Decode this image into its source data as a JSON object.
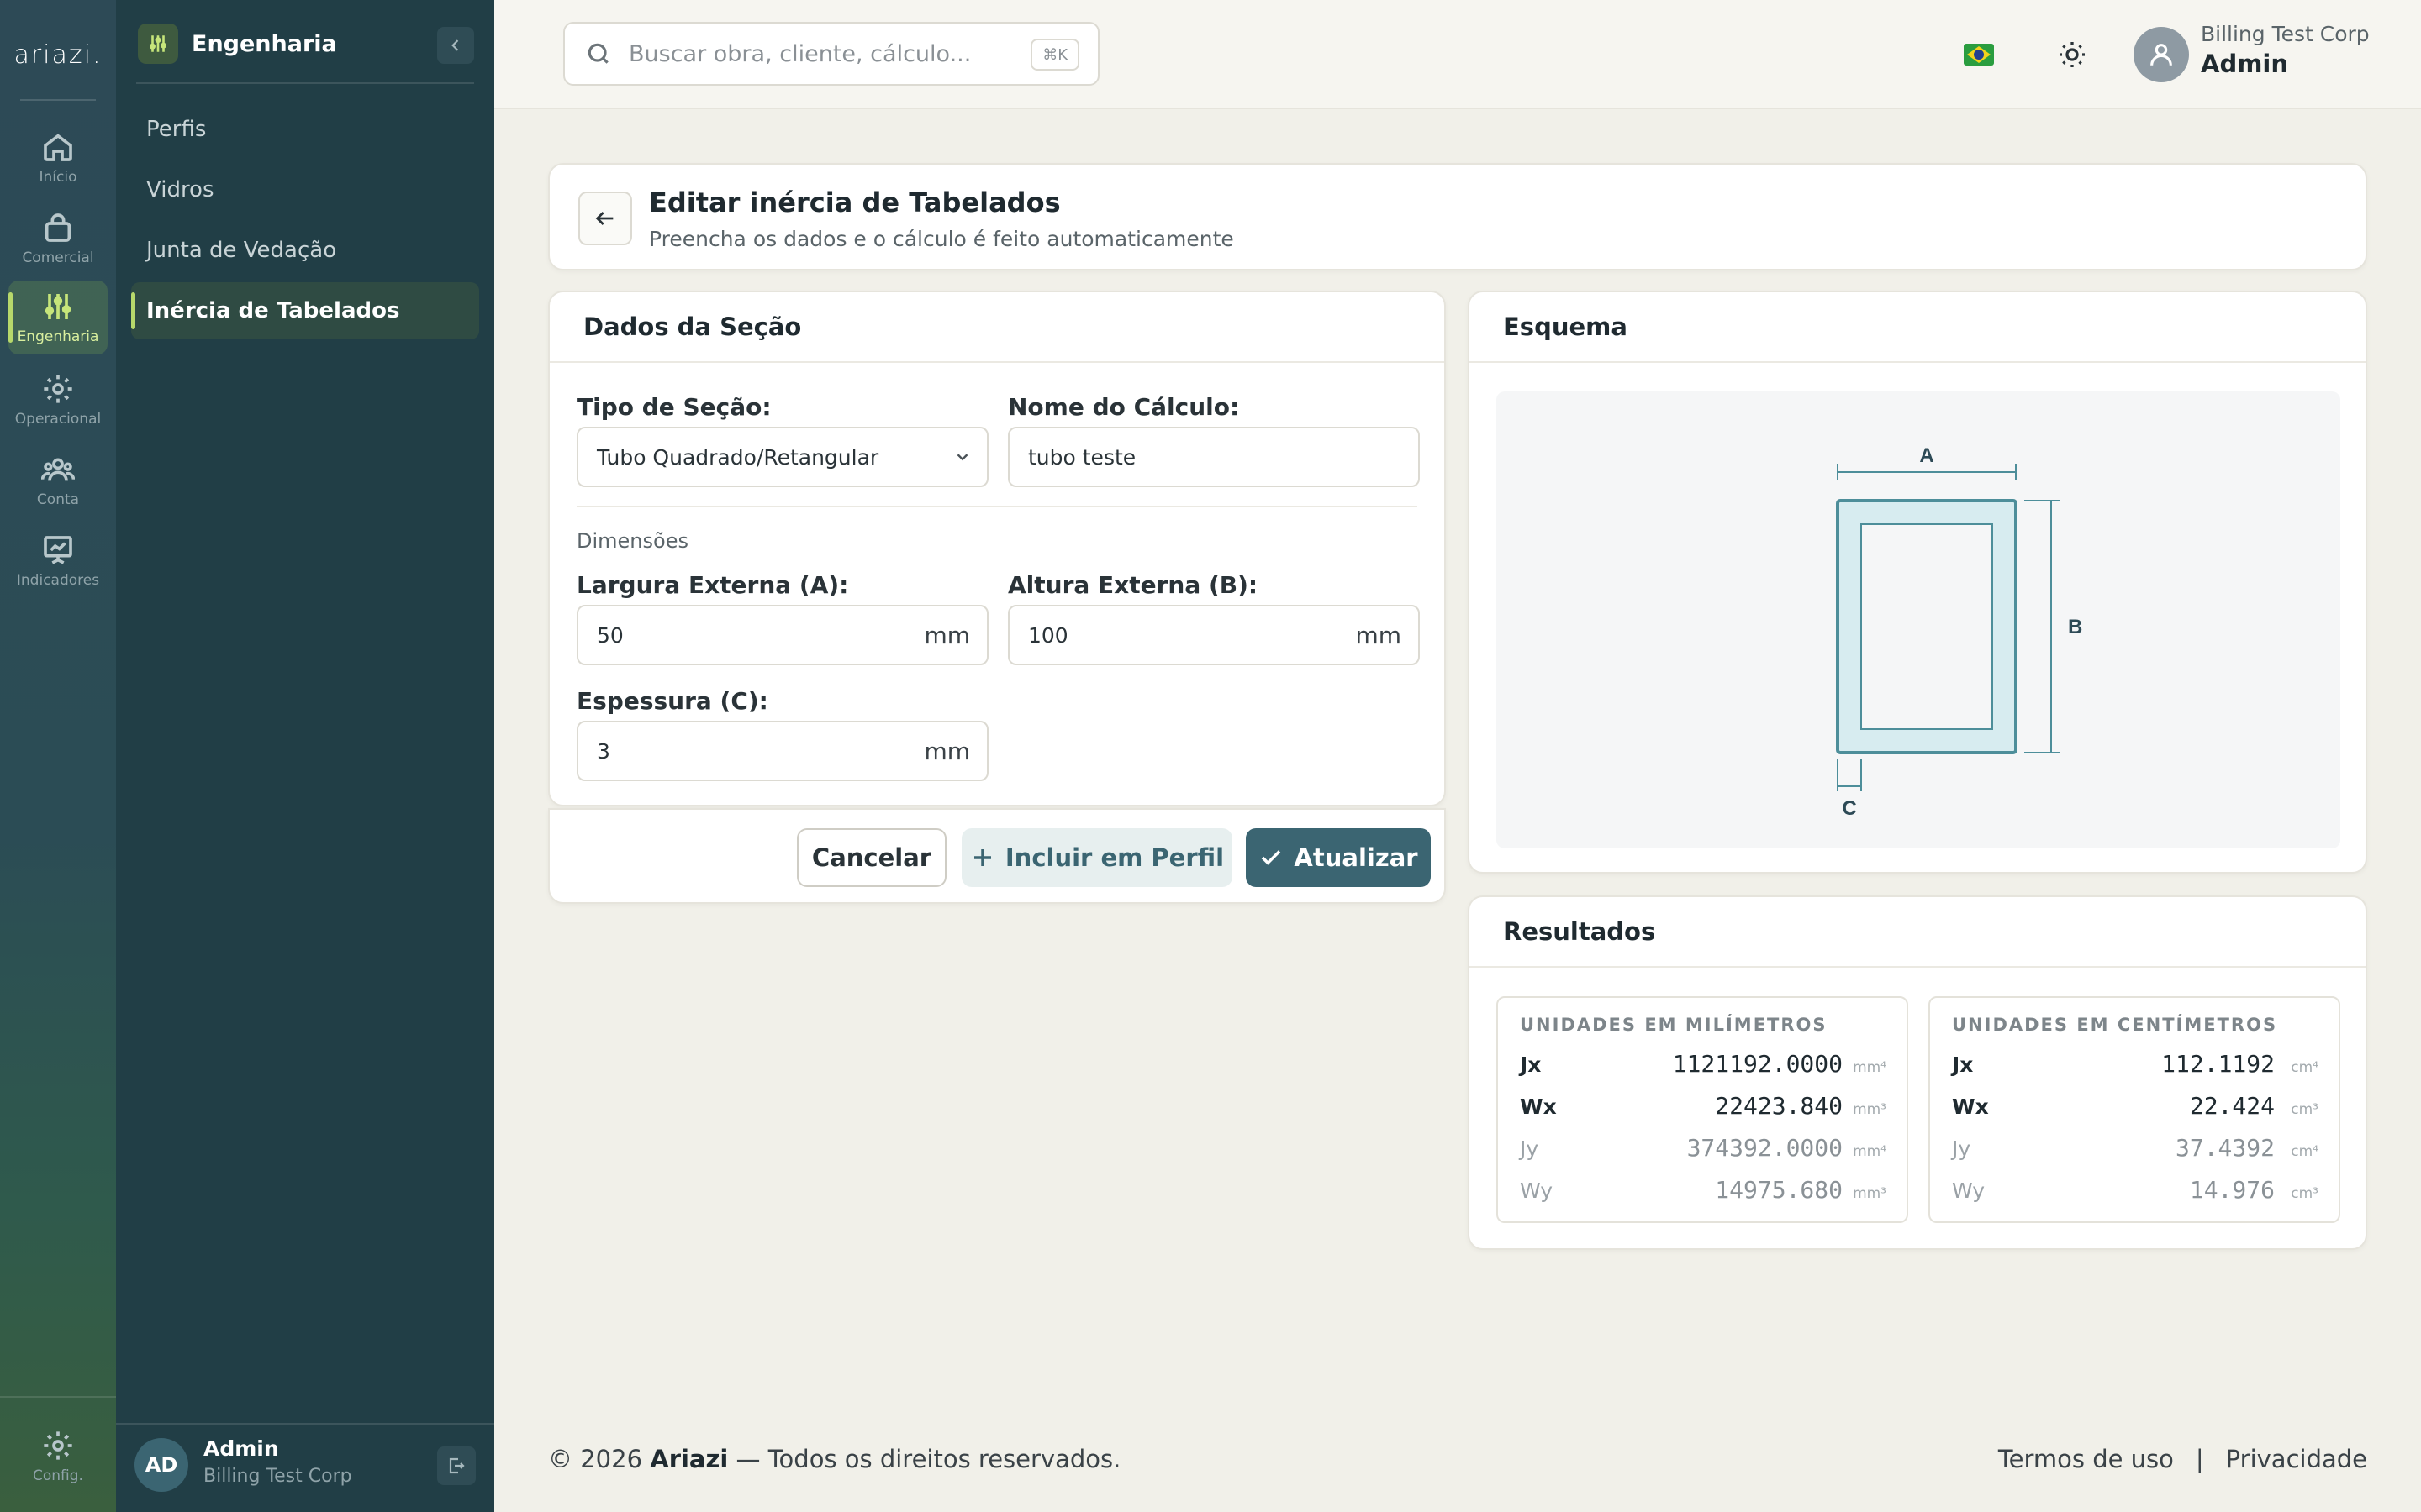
{
  "rail": {
    "logo": "ariazi.",
    "items": [
      {
        "label": "Início",
        "icon": "home-icon"
      },
      {
        "label": "Comercial",
        "icon": "bag-icon"
      },
      {
        "label": "Engenharia",
        "icon": "sliders-icon"
      },
      {
        "label": "Operacional",
        "icon": "gear-icon"
      },
      {
        "label": "Conta",
        "icon": "users-icon"
      },
      {
        "label": "Indicadores",
        "icon": "presentation-icon"
      }
    ],
    "config_label": "Config."
  },
  "sidebar": {
    "title": "Engenharia",
    "items": [
      {
        "label": "Perfis"
      },
      {
        "label": "Vidros"
      },
      {
        "label": "Junta de Vedação"
      },
      {
        "label": "Inércia de Tabelados"
      }
    ],
    "user": {
      "initials": "AD",
      "name": "Admin",
      "org": "Billing Test Corp"
    }
  },
  "topbar": {
    "search_placeholder": "Buscar obra, cliente, cálculo...",
    "search_shortcut": "⌘K",
    "user_org": "Billing Test Corp",
    "user_role": "Admin"
  },
  "header": {
    "title": "Editar inércia de Tabelados",
    "subtitle": "Preencha os dados e o cálculo é feito automaticamente"
  },
  "section": {
    "title": "Dados da Seção",
    "type_label": "Tipo de Seção:",
    "type_value": "Tubo Quadrado/Retangular",
    "name_label": "Nome do Cálculo:",
    "name_value": "tubo teste",
    "dimensions_label": "Dimensões",
    "width_label": "Largura Externa (A):",
    "width_value": "50",
    "height_label": "Altura Externa (B):",
    "height_value": "100",
    "thickness_label": "Espessura (C):",
    "thickness_value": "3",
    "unit": "mm"
  },
  "actions": {
    "cancel": "Cancelar",
    "include": "Incluir em Perfil",
    "update": "Atualizar"
  },
  "schema": {
    "title": "Esquema",
    "label_a": "A",
    "label_b": "B",
    "label_c": "C"
  },
  "results": {
    "title": "Resultados",
    "mm": {
      "title": "UNIDADES EM MILÍMETROS",
      "rows": [
        {
          "key": "Jx",
          "value": "1121192.0000",
          "unit": "mm⁴"
        },
        {
          "key": "Wx",
          "value": "22423.840",
          "unit": "mm³"
        },
        {
          "key": "Jy",
          "value": "374392.0000",
          "unit": "mm⁴"
        },
        {
          "key": "Wy",
          "value": "14975.680",
          "unit": "mm³"
        }
      ]
    },
    "cm": {
      "title": "UNIDADES EM CENTÍMETROS",
      "rows": [
        {
          "key": "Jx",
          "value": "112.1192",
          "unit": "cm⁴"
        },
        {
          "key": "Wx",
          "value": "22.424",
          "unit": "cm³"
        },
        {
          "key": "Jy",
          "value": "37.4392",
          "unit": "cm⁴"
        },
        {
          "key": "Wy",
          "value": "14.976",
          "unit": "cm³"
        }
      ]
    }
  },
  "footer": {
    "copyright_prefix": "© 2026",
    "brand": "Ariazi",
    "copyright_suffix": "— Todos os direitos reservados.",
    "terms": "Termos de uso",
    "separator": "|",
    "privacy": "Privacidade"
  },
  "colors": {
    "accent": "#3b6572",
    "active_green": "#b7d86b",
    "sidebar_bg": "#213e46"
  }
}
